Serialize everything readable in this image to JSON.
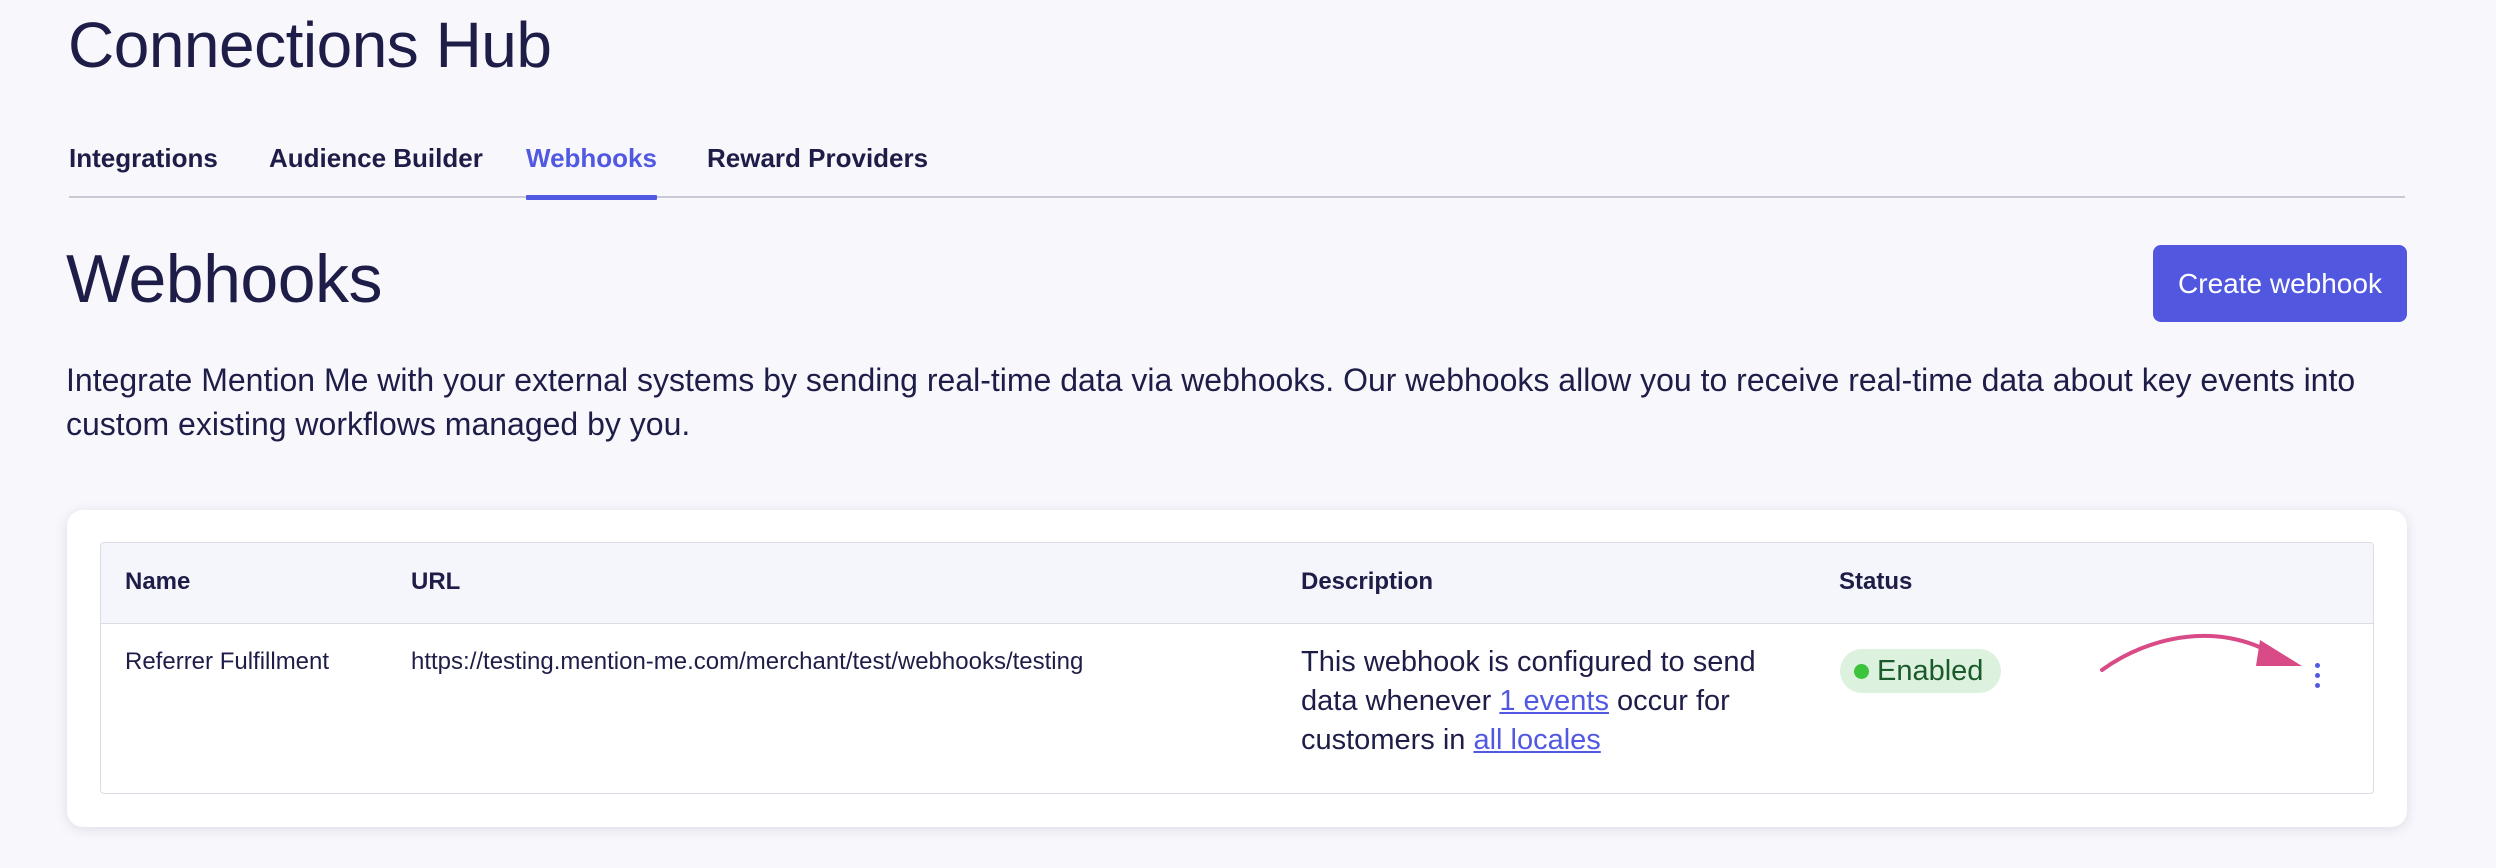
{
  "hub": {
    "title": "Connections Hub"
  },
  "tabs": [
    {
      "label": "Integrations",
      "active": false
    },
    {
      "label": "Audience Builder",
      "active": false
    },
    {
      "label": "Webhooks",
      "active": true
    },
    {
      "label": "Reward Providers",
      "active": false
    }
  ],
  "section": {
    "title": "Webhooks",
    "create_label": "Create webhook",
    "intro": "Integrate Mention Me with your external systems by sending real-time data via webhooks. Our webhooks allow you to receive real-time data about key events into custom existing workflows managed by you."
  },
  "table": {
    "headers": {
      "name": "Name",
      "url": "URL",
      "description": "Description",
      "status": "Status"
    },
    "rows": [
      {
        "name": "Referrer Fulfillment",
        "url": "https://testing.mention-me.com/merchant/test/webhooks/testing",
        "description": {
          "prefix": "This webhook is configured to send data whenever ",
          "events_link": "1 events",
          "middle": " occur for customers in ",
          "locales_link": "all locales"
        },
        "status": "Enabled",
        "actions_icon": "kebab-menu-icon"
      }
    ]
  },
  "colors": {
    "accent": "#5158e2",
    "enabled_bg": "#dcf2df",
    "enabled_dot": "#3cc43c",
    "annotation_arrow": "#d94b86"
  }
}
